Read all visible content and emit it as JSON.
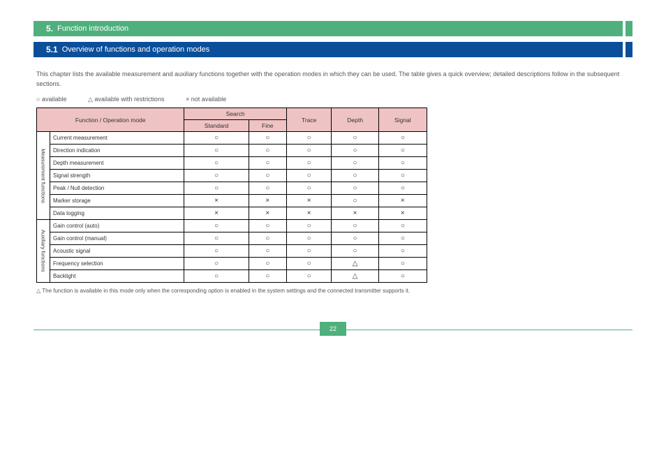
{
  "greenBanner": {
    "num": "5.",
    "title": "Function introduction"
  },
  "blueBanner": {
    "num": "5.1",
    "title": "Overview of functions and operation modes"
  },
  "intro": "This chapter lists the available measurement and auxiliary functions together with the operation modes in which they can be used. The table gives a quick overview; detailed descriptions follow in the subsequent sections.",
  "legend": {
    "ok": "○ available",
    "cond": "△ available with restrictions",
    "no": "× not available"
  },
  "headers": {
    "funcOp": "Function / Operation mode",
    "search": "Search",
    "searchStd": "Standard",
    "searchFine": "Fine",
    "trace": "Trace",
    "depth": "Depth",
    "signal": "Signal"
  },
  "groups": {
    "meas": "Measurement functions",
    "aux": "Auxiliary functions"
  },
  "rows": [
    {
      "g": "meas",
      "name": "Current measurement",
      "c": [
        "○",
        "○",
        "○",
        "○",
        "○"
      ]
    },
    {
      "g": "meas",
      "name": "Direction indication",
      "c": [
        "○",
        "○",
        "○",
        "○",
        "○"
      ]
    },
    {
      "g": "meas",
      "name": "Depth measurement",
      "c": [
        "○",
        "○",
        "○",
        "○",
        "○"
      ]
    },
    {
      "g": "meas",
      "name": "Signal strength",
      "c": [
        "○",
        "○",
        "○",
        "○",
        "○"
      ]
    },
    {
      "g": "meas",
      "name": "Peak / Null detection",
      "c": [
        "○",
        "○",
        "○",
        "○",
        "○"
      ]
    },
    {
      "g": "meas",
      "name": "Marker storage",
      "c": [
        "×",
        "×",
        "×",
        "○",
        "×"
      ]
    },
    {
      "g": "meas",
      "name": "Data logging",
      "c": [
        "×",
        "×",
        "×",
        "×",
        "×"
      ]
    },
    {
      "g": "aux",
      "name": "Gain control (auto)",
      "c": [
        "○",
        "○",
        "○",
        "○",
        "○"
      ]
    },
    {
      "g": "aux",
      "name": "Gain control (manual)",
      "c": [
        "○",
        "○",
        "○",
        "○",
        "○"
      ]
    },
    {
      "g": "aux",
      "name": "Acoustic signal",
      "c": [
        "○",
        "○",
        "○",
        "○",
        "○"
      ]
    },
    {
      "g": "aux",
      "name": "Frequency selection",
      "c": [
        "○",
        "○",
        "○",
        "△",
        "○"
      ]
    },
    {
      "g": "aux",
      "name": "Backlight",
      "c": [
        "○",
        "○",
        "○",
        "△",
        "○"
      ]
    }
  ],
  "footnote": "△  The function is available in this mode only when the corresponding option is enabled in the system settings and the connected transmitter supports it.",
  "page": "22",
  "symbols": {
    "circle": "○",
    "triangle": "△",
    "cross": "×"
  }
}
